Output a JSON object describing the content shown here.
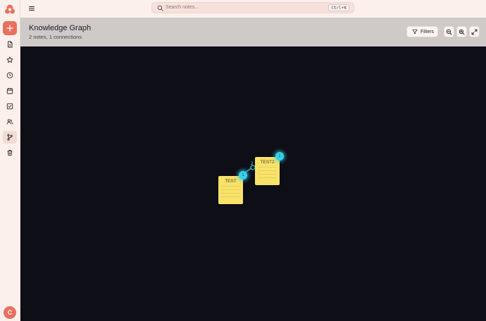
{
  "app": {
    "search": {
      "placeholder": "Search notes...",
      "shortcut": "Ctrl+K"
    },
    "user": {
      "initial": "C"
    }
  },
  "sidebar": {
    "items": [
      {
        "icon": "document-icon"
      },
      {
        "icon": "star-icon"
      },
      {
        "icon": "clock-icon"
      },
      {
        "icon": "calendar-icon"
      },
      {
        "icon": "checkbox-icon"
      },
      {
        "icon": "users-icon"
      },
      {
        "icon": "git-branch-icon",
        "active": true
      },
      {
        "icon": "trash-icon"
      }
    ]
  },
  "header": {
    "title": "Knowledge Graph",
    "subtitle": "2 notes, 1 connections",
    "filters_label": "Filters"
  },
  "graph": {
    "nodes": [
      {
        "label": "TEST",
        "connections": "1"
      },
      {
        "label": "TEST2",
        "connections": "1"
      }
    ],
    "edge_label": "2",
    "colors": {
      "background": "#0e0e16",
      "note": "#f8e26a",
      "badge": "#37d0ea",
      "accent": "#e8705f"
    }
  }
}
